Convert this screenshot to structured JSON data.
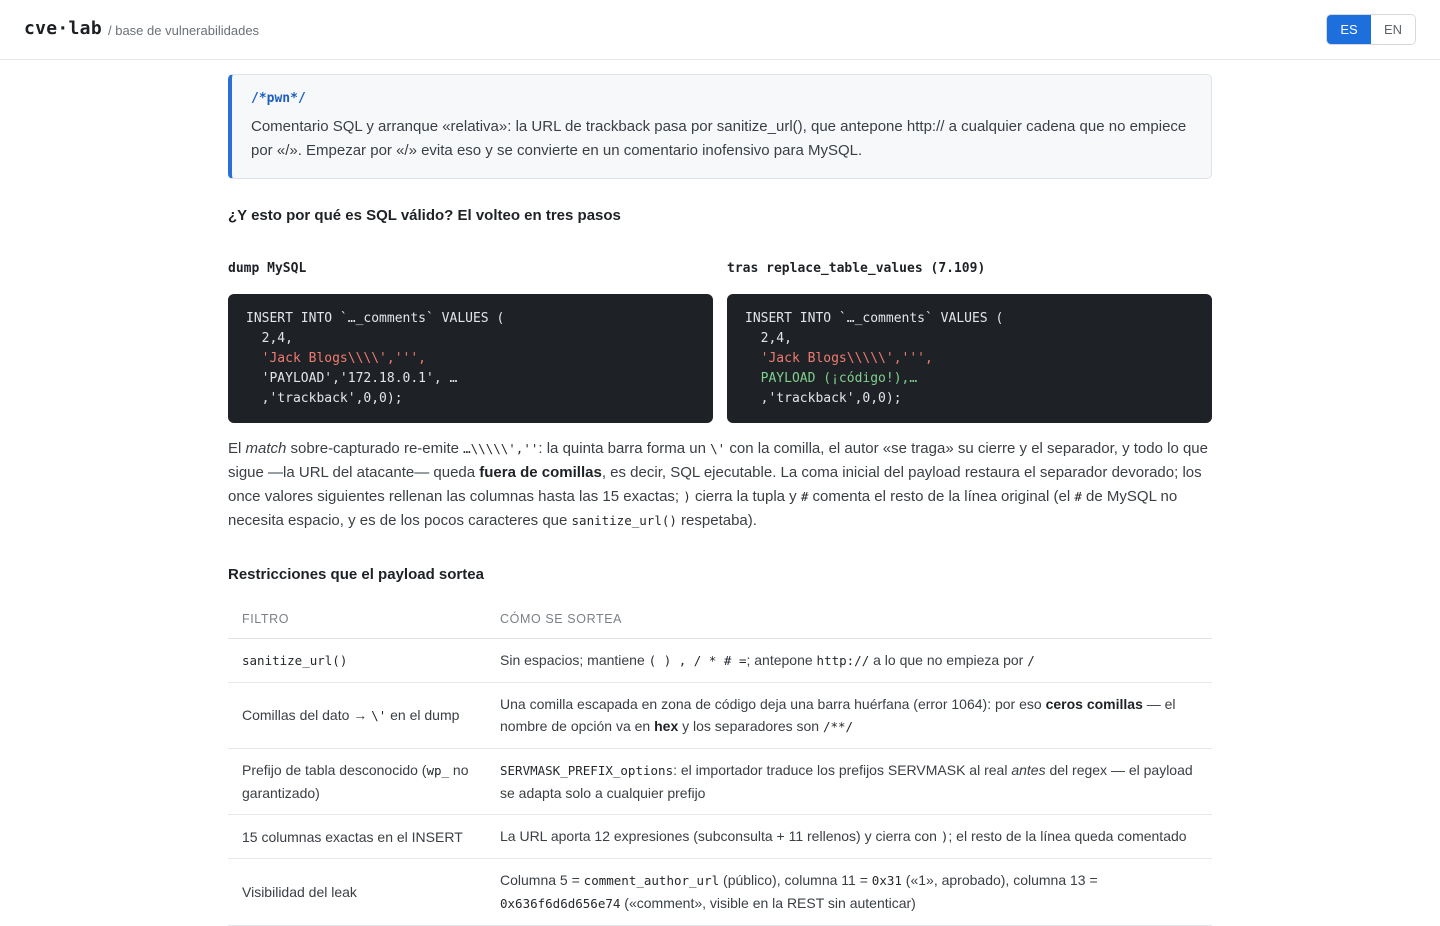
{
  "header": {
    "brand": "cve·lab",
    "subtitle": "/ base de vulnerabilidades",
    "lang_options": [
      "ES",
      "EN"
    ],
    "lang_active": "ES",
    "accent_color": "#1c6fdc"
  },
  "callout": {
    "code": "/*pwn*/",
    "text": "Comentario SQL y arranque «relativa»: la URL de trackback pasa por sanitize_url(), que antepone http:// a cualquier cadena que no empiece por «/». Empezar por «/» evita eso y se convierte en un comentario inofensivo para MySQL."
  },
  "steps_heading": "¿Y esto por qué es SQL válido? El volteo en tres pasos",
  "dump": {
    "title": "dump MySQL",
    "lines": [
      "INSERT INTO `…_comments` VALUES (",
      "  2,4,",
      "  'Jack Blogs\\\\\\\\',''',",
      "  'PAYLOAD','172.18.0.1', …",
      "  ,'trackback',0,0);"
    ]
  },
  "replaced": {
    "title": "tras replace_table_values (7.109)",
    "lines": [
      "INSERT INTO `…_comments` VALUES (",
      "  2,4,",
      "  'Jack Blogs\\\\\\\\\\',''',",
      "  PAYLOAD (¡código!),…",
      "  ,'trackback',0,0);"
    ]
  },
  "explanation": {
    "p1": "El ",
    "p2": "match",
    "p3": " sobre-capturado re-emite ",
    "c1": "…\\\\\\\\\\',''",
    "p4": ": la quinta barra forma un ",
    "c2": "\\'",
    "p5": " con la comilla, el autor «se traga» su cierre y el separador, y todo lo que sigue —la URL del atacante— queda ",
    "b1": "fuera de comillas",
    "p6": ", es decir, SQL ejecutable. La coma inicial del payload restaura el separador devorado; los once valores siguientes rellenan las columnas hasta las 15 exactas; ",
    "c3": ")",
    "p7": " cierra la tupla y ",
    "c4": "#",
    "p8": " comenta el resto de la línea original (el ",
    "c5": "#",
    "p9": " de MySQL no necesita espacio, y es de los pocos caracteres que ",
    "c6": "sanitize_url()",
    "p10": " respetaba)."
  },
  "restrictions": {
    "heading": "Restricciones que el payload sortea",
    "col_filter": "FILTRO",
    "col_how": "CÓMO SE SORTEA",
    "row1": {
      "filter": "sanitize_url()",
      "h1": "Sin espacios; mantiene ",
      "hc1": "( ) , / * # =",
      "h2": "; antepone ",
      "hc2": "http://",
      "h3": " a lo que no empieza por ",
      "hc3": "/"
    },
    "row2": {
      "f1": "Comillas del dato → ",
      "fc1": "\\'",
      "f2": " en el dump",
      "h1": "Una comilla escapada en zona de código deja una barra huérfana (error 1064): por eso ",
      "hb1": "ceros comillas",
      "h2": " — el nombre de opción va en ",
      "hb2": "hex",
      "h3": " y los separadores son ",
      "hc1": "/**/"
    },
    "row3": {
      "f1": "Prefijo de tabla desconocido (",
      "fc1": "wp_",
      "f2": " no garantizado)",
      "hc1": "SERVMASK_PREFIX_options",
      "h1": ": el importador traduce los prefijos SERVMASK al real ",
      "hi1": "antes",
      "h2": " del regex — el payload se adapta solo a cualquier prefijo"
    },
    "row4": {
      "filter": "15 columnas exactas en el INSERT",
      "h1": "La URL aporta 12 expresiones (subconsulta + 11 rellenos) y cierra con ",
      "hc1": ")",
      "h2": "; el resto de la línea queda comentado"
    },
    "row5": {
      "filter": "Visibilidad del leak",
      "h1": "Columna 5 = ",
      "hc1": "comment_author_url",
      "h2": " (público), columna 11 = ",
      "hc2": "0x31",
      "h3": " («1», aprobado), columna 13 = ",
      "hc3": "0x636f6d6d656e74",
      "h4": " («comment», visible en la REST sin autenticar)"
    }
  }
}
